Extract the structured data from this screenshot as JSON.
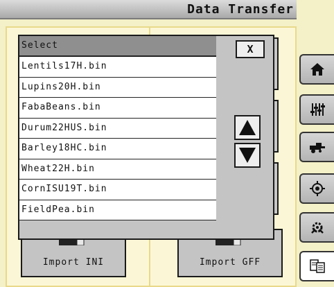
{
  "header": {
    "title": "Data Transfer"
  },
  "dialog": {
    "header_label": "Select",
    "close_label": "X",
    "files": [
      "Lentils17H.bin",
      "Lupins20H.bin",
      "FabaBeans.bin",
      "Durum22HUS.bin",
      "Barley18HC.bin",
      "Wheat22H.bin",
      "CornISU19T.bin",
      "FieldPea.bin"
    ]
  },
  "buttons": {
    "import_ini": "Import INI",
    "import_gff": "Import GFF"
  },
  "sidebar": {
    "items": [
      {
        "icon": "home-icon"
      },
      {
        "icon": "sliders-icon"
      },
      {
        "icon": "harvester-icon"
      },
      {
        "icon": "target-icon"
      },
      {
        "icon": "gear-tools-icon"
      },
      {
        "icon": "data-transfer-icon",
        "active": true
      }
    ]
  }
}
